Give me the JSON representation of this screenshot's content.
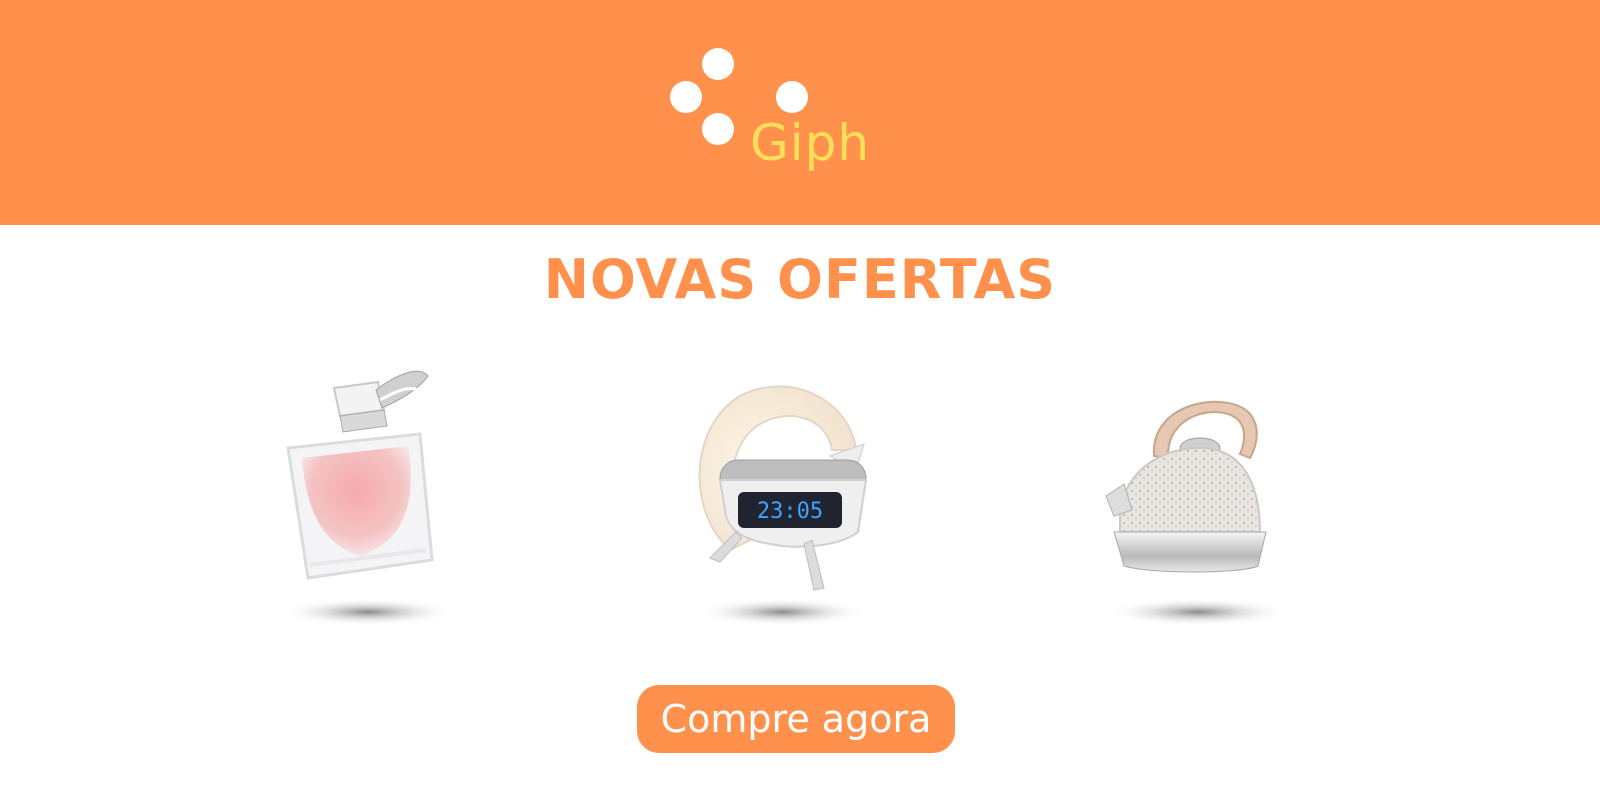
{
  "brand": {
    "name": "Giph",
    "logo_icon": "four-dots-logo-icon"
  },
  "colors": {
    "accent": "#ff914d",
    "brand_text": "#ffde59",
    "background": "#ffffff"
  },
  "banner": {
    "title": "NOVAS OFERTAS"
  },
  "products": [
    {
      "icon": "perfume-bottle-icon"
    },
    {
      "icon": "lamp-clock-speaker-icon",
      "clock_display": "23:05"
    },
    {
      "icon": "kettle-icon"
    }
  ],
  "cta": {
    "label": "Compre agora"
  }
}
